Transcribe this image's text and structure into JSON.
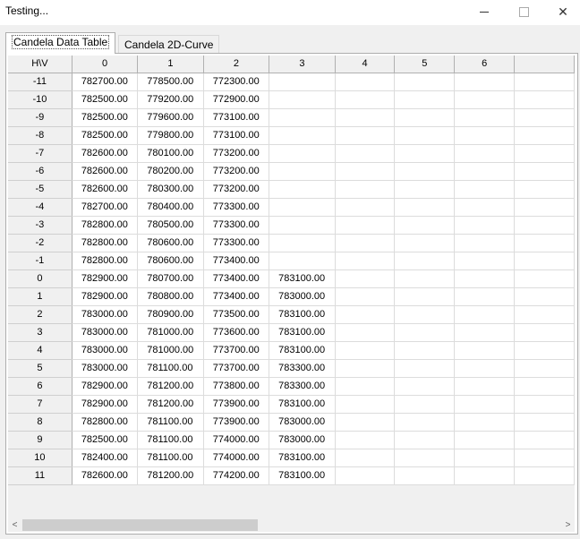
{
  "window": {
    "title": "Testing...",
    "min_glyph": "",
    "close_glyph": "✕"
  },
  "tabs": [
    {
      "label": "Candela Data Table",
      "active": true
    },
    {
      "label": "Candela 2D-Curve",
      "active": false
    }
  ],
  "table": {
    "corner": "H\\V",
    "columns": [
      "0",
      "1",
      "2",
      "3",
      "4",
      "5",
      "6",
      ""
    ],
    "rows": [
      {
        "h": "-11",
        "v": [
          "782700.00",
          "778500.00",
          "772300.00",
          ""
        ]
      },
      {
        "h": "-10",
        "v": [
          "782500.00",
          "779200.00",
          "772900.00",
          ""
        ]
      },
      {
        "h": "-9",
        "v": [
          "782500.00",
          "779600.00",
          "773100.00",
          ""
        ]
      },
      {
        "h": "-8",
        "v": [
          "782500.00",
          "779800.00",
          "773100.00",
          ""
        ]
      },
      {
        "h": "-7",
        "v": [
          "782600.00",
          "780100.00",
          "773200.00",
          ""
        ]
      },
      {
        "h": "-6",
        "v": [
          "782600.00",
          "780200.00",
          "773200.00",
          ""
        ]
      },
      {
        "h": "-5",
        "v": [
          "782600.00",
          "780300.00",
          "773200.00",
          ""
        ]
      },
      {
        "h": "-4",
        "v": [
          "782700.00",
          "780400.00",
          "773300.00",
          ""
        ]
      },
      {
        "h": "-3",
        "v": [
          "782800.00",
          "780500.00",
          "773300.00",
          ""
        ]
      },
      {
        "h": "-2",
        "v": [
          "782800.00",
          "780600.00",
          "773300.00",
          ""
        ]
      },
      {
        "h": "-1",
        "v": [
          "782800.00",
          "780600.00",
          "773400.00",
          ""
        ]
      },
      {
        "h": "0",
        "v": [
          "782900.00",
          "780700.00",
          "773400.00",
          "783100.00"
        ]
      },
      {
        "h": "1",
        "v": [
          "782900.00",
          "780800.00",
          "773400.00",
          "783000.00"
        ]
      },
      {
        "h": "2",
        "v": [
          "783000.00",
          "780900.00",
          "773500.00",
          "783100.00"
        ]
      },
      {
        "h": "3",
        "v": [
          "783000.00",
          "781000.00",
          "773600.00",
          "783100.00"
        ]
      },
      {
        "h": "4",
        "v": [
          "783000.00",
          "781000.00",
          "773700.00",
          "783100.00"
        ]
      },
      {
        "h": "5",
        "v": [
          "783000.00",
          "781100.00",
          "773700.00",
          "783300.00"
        ]
      },
      {
        "h": "6",
        "v": [
          "782900.00",
          "781200.00",
          "773800.00",
          "783300.00"
        ]
      },
      {
        "h": "7",
        "v": [
          "782900.00",
          "781200.00",
          "773900.00",
          "783100.00"
        ]
      },
      {
        "h": "8",
        "v": [
          "782800.00",
          "781100.00",
          "773900.00",
          "783000.00"
        ]
      },
      {
        "h": "9",
        "v": [
          "782500.00",
          "781100.00",
          "774000.00",
          "783000.00"
        ]
      },
      {
        "h": "10",
        "v": [
          "782400.00",
          "781100.00",
          "774000.00",
          "783100.00"
        ]
      },
      {
        "h": "11",
        "v": [
          "782600.00",
          "781200.00",
          "774200.00",
          "783100.00"
        ]
      }
    ]
  },
  "scrollbar": {
    "left_glyph": "<",
    "right_glyph": ">",
    "position": 0
  }
}
